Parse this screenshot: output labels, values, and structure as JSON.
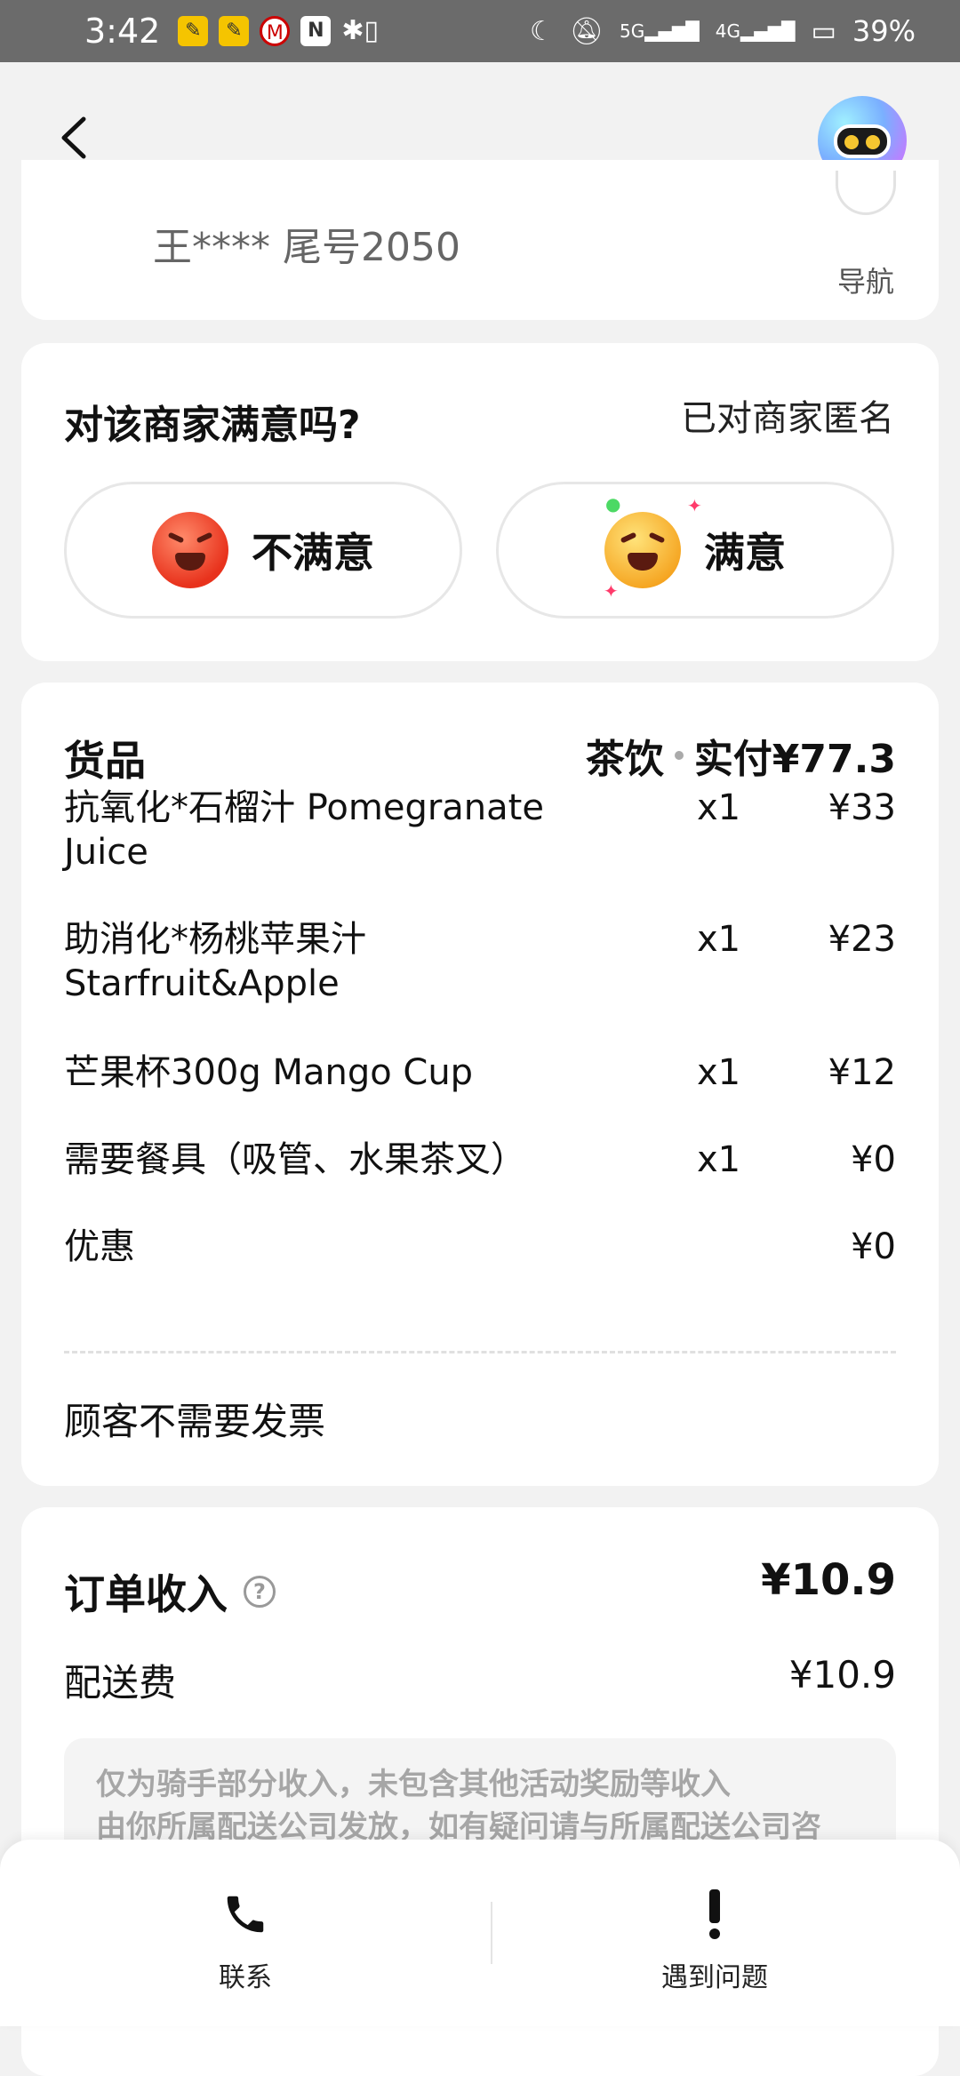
{
  "status_bar": {
    "time": "3:42",
    "icons_left": [
      "app-notify-icon",
      "app-notify-icon",
      "bank-icon",
      "nfc-icon",
      "bluetooth-icon"
    ],
    "signal_5g": "5G",
    "signal_4g": "4G",
    "battery": "39%"
  },
  "header": {
    "back_icon": "chevron-left-icon",
    "assistant_icon": "robot-avatar-icon"
  },
  "customer": {
    "name": "王**** 尾号2050",
    "nav_label": "导航"
  },
  "rating": {
    "question": "对该商家满意吗?",
    "anonymous_note": "已对商家匿名",
    "dissatisfied_label": "不满意",
    "satisfied_label": "满意"
  },
  "goods": {
    "title": "货品",
    "category": "茶饮",
    "paid_label": "实付¥77.3",
    "items": [
      {
        "name": "抗氧化*石榴汁 Pomegranate Juice",
        "qty": "x1",
        "price": "¥33"
      },
      {
        "name": "助消化*杨桃苹果汁 Starfruit&Apple",
        "qty": "x1",
        "price": "¥23"
      },
      {
        "name": "芒果杯300g Mango Cup",
        "qty": "x1",
        "price": "¥12"
      },
      {
        "name": "需要餐具（吸管、水果茶叉）",
        "qty": "x1",
        "price": "¥0"
      },
      {
        "name": "优惠",
        "qty": "",
        "price": "¥0"
      }
    ],
    "invoice_note": "顾客不需要发票"
  },
  "income": {
    "title": "订单收入",
    "total": "¥10.9",
    "fee_label": "配送费",
    "fee_value": "¥10.9",
    "note_line1": "仅为骑手部分收入，未包含其他活动奖励等收入",
    "note_line2": "由你所属配送公司发放，如有疑问请与所属配送公司咨"
  },
  "bottom_bar": {
    "contact_label": "联系",
    "problem_label": "遇到问题"
  },
  "colors": {
    "background": "#f2f2f2",
    "card": "#ffffff",
    "status_bar": "#6b6b6b"
  }
}
